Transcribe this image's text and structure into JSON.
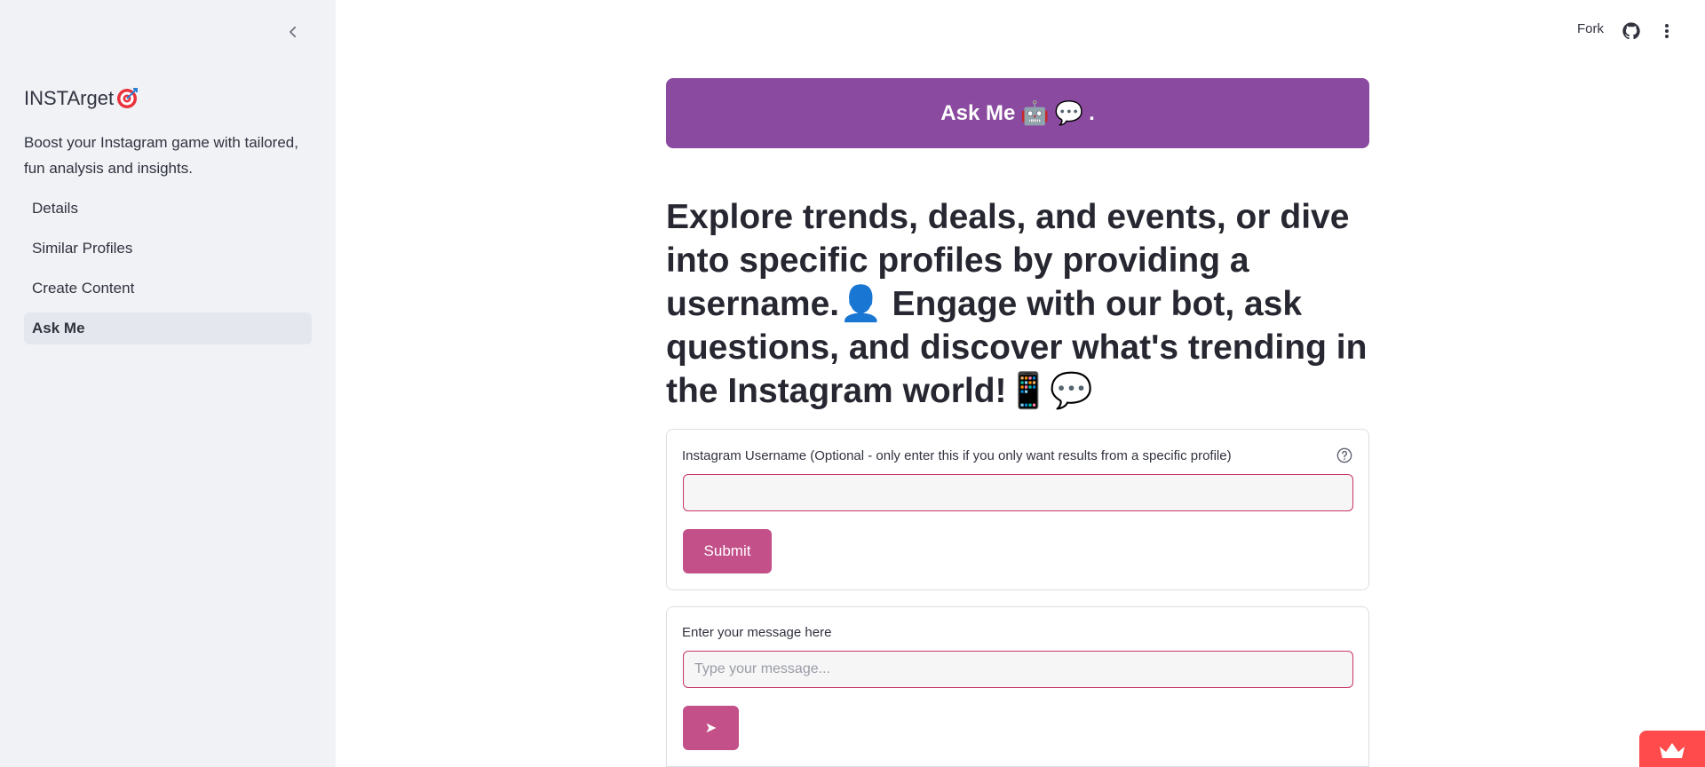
{
  "sidebar": {
    "title": "INSTArget",
    "title_icon": "target-icon",
    "tagline": "Boost your Instagram game with tailored, fun analysis and insights.",
    "nav": [
      {
        "label": "Details",
        "active": false
      },
      {
        "label": "Similar Profiles",
        "active": false
      },
      {
        "label": "Create Content",
        "active": false
      },
      {
        "label": "Ask Me",
        "active": true
      }
    ]
  },
  "header": {
    "fork_label": "Fork",
    "icons": [
      "github-icon",
      "more-vertical-icon"
    ]
  },
  "main": {
    "banner": {
      "text": "Ask Me",
      "emoji_robot": "🤖",
      "emoji_speech": "💬",
      "suffix": "."
    },
    "headline": {
      "line_a": "Explore trends, deals, and events, or dive into specific profiles by providing a username.",
      "emoji_person": "👤",
      "line_b": "Engage with our bot, ask questions, and discover what's trending in the Instagram world!",
      "emoji_phone": "📱",
      "emoji_speech": "💬"
    },
    "username_form": {
      "label": "Instagram Username (Optional - only enter this if you only want results from a specific profile)",
      "value": "",
      "submit_label": "Submit"
    },
    "message_form": {
      "label": "Enter your message here",
      "placeholder": "Type your message...",
      "send_label": "➤"
    }
  },
  "colors": {
    "sidebar_bg": "#f0f2f6",
    "banner_bg": "#8a4a9f",
    "button_bg": "#c4508a",
    "input_border": "#c9356b",
    "badge_bg": "#ff4b4b"
  }
}
